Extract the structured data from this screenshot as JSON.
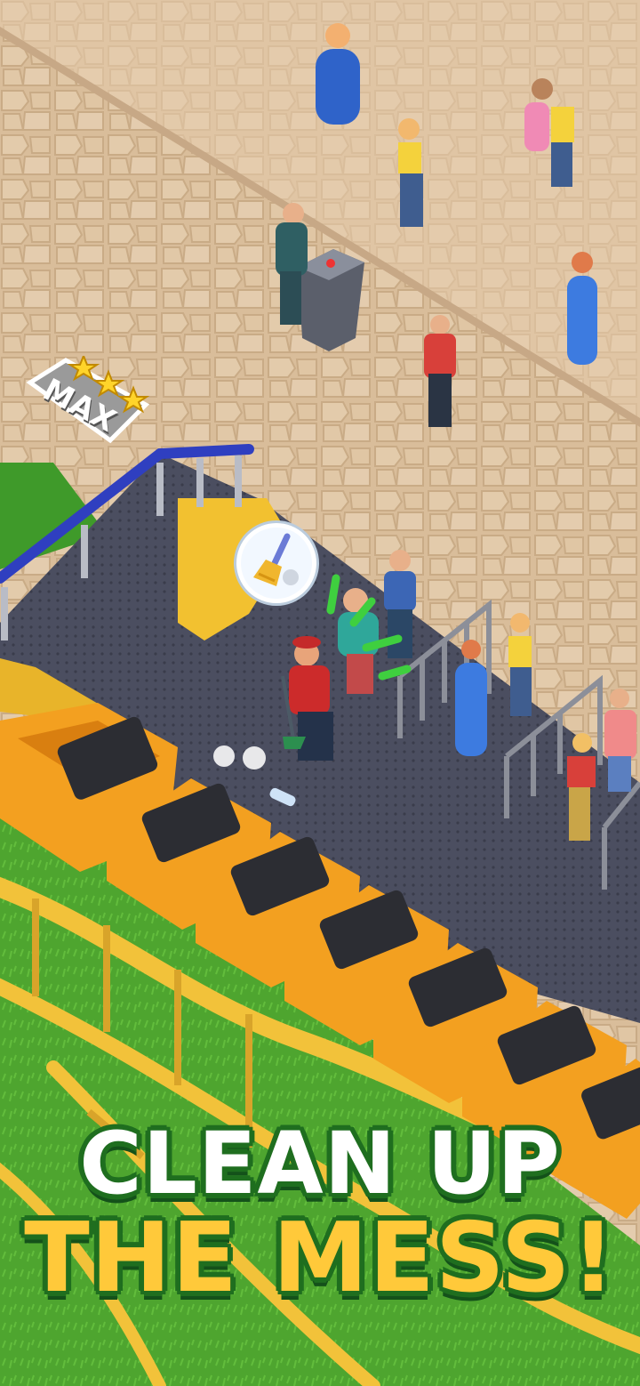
{
  "headline": {
    "line1": "CLEAN UP",
    "line2": "THE MESS!"
  },
  "badge": {
    "label": "MAX",
    "stars": 3
  },
  "task_icon": "broom-icon",
  "colors": {
    "plaza": "#dcc3a2",
    "plaza_stone": "#cfb392",
    "platform": "#4a4d5e",
    "grass": "#4fa830",
    "track": "#f2c23a",
    "railing_blue": "#2f3fc0",
    "cart": "#f3a020",
    "headline_white": "#ffffff",
    "headline_yellow": "#ffc93a",
    "headline_outline": "#1f6e1f",
    "progress_green": "#3fcf3f"
  }
}
